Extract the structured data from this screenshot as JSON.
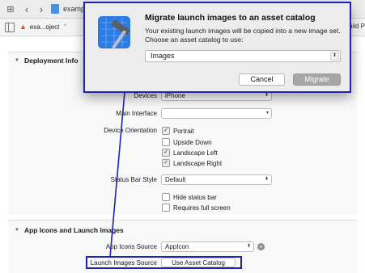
{
  "toolbar": {
    "title": "examp",
    "icons": [
      "grid-icon",
      "back-icon",
      "forward-icon",
      "file-icon"
    ]
  },
  "tabbar": {
    "target_label": "exa...oject",
    "right_text": "uild P"
  },
  "deployment": {
    "section_title": "Deployment Info",
    "devices_label": "Devices",
    "devices_value": "iPhone",
    "main_interface_label": "Main Interface",
    "main_interface_value": "",
    "orientation_label": "Device Orientation",
    "orientations": [
      {
        "label": "Portrait",
        "checked": true
      },
      {
        "label": "Upside Down",
        "checked": false
      },
      {
        "label": "Landscape Left",
        "checked": true
      },
      {
        "label": "Landscape Right",
        "checked": true
      }
    ],
    "status_bar_label": "Status Bar Style",
    "status_bar_value": "Default",
    "hide_status_bar": "Hide status bar",
    "requires_full_screen": "Requires full screen"
  },
  "app_icons": {
    "section_title": "App Icons and Launch Images",
    "app_icons_source_label": "App Icons Source",
    "app_icons_source_value": "AppIcon",
    "launch_images_source_label": "Launch Images Source",
    "use_asset_catalog": "Use Asset Catalog"
  },
  "dialog": {
    "title": "Migrate launch images to an asset catalog",
    "message": "Your existing launch images will be copied into a new image set. Choose an asset catalog to use:",
    "selected_catalog": "Images",
    "cancel_label": "Cancel",
    "migrate_label": "Migrate"
  },
  "colors": {
    "highlight": "#2121b5",
    "checkmark": "#333333"
  }
}
